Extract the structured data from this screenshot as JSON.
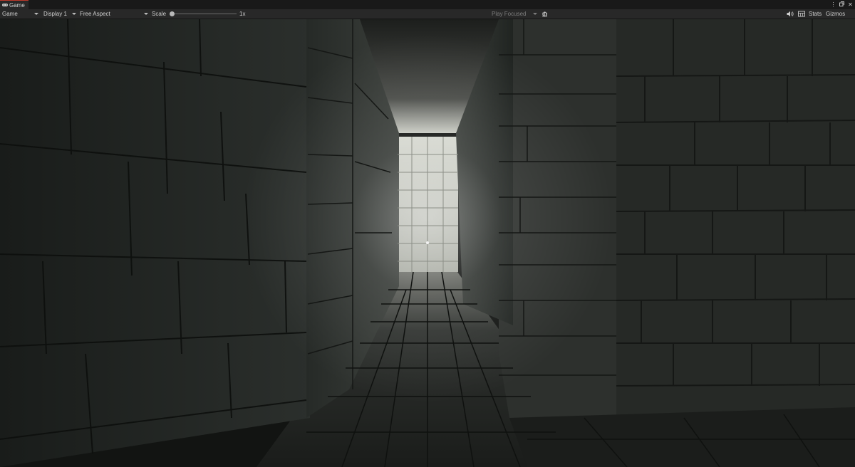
{
  "tab": {
    "title": "Game",
    "icon": "game-controller-icon",
    "accent": "#c0392b"
  },
  "window_controls": [
    "menu-dots-icon",
    "maximize-icon",
    "close-icon"
  ],
  "toolbar": {
    "mode": "Game",
    "display": "Display 1",
    "aspect": "Free Aspect",
    "scale_label": "Scale",
    "scale_value": "1x",
    "scale_level": 0.0,
    "play_mode": "Play Focused",
    "stats_label": "Stats",
    "gizmos_label": "Gizmos",
    "icons": [
      "bug-icon",
      "audio-mute-icon",
      "frame-debugger-icon"
    ]
  },
  "scene": {
    "description_tag": "stone-dungeon-corridor",
    "crosshair": "center-dot"
  },
  "colors": {
    "tab_bg": "#282828",
    "toolbar_bg": "#282828",
    "text": "#cfcfcf",
    "wall_dark": "#1f2320",
    "light": "#e0e2da"
  }
}
